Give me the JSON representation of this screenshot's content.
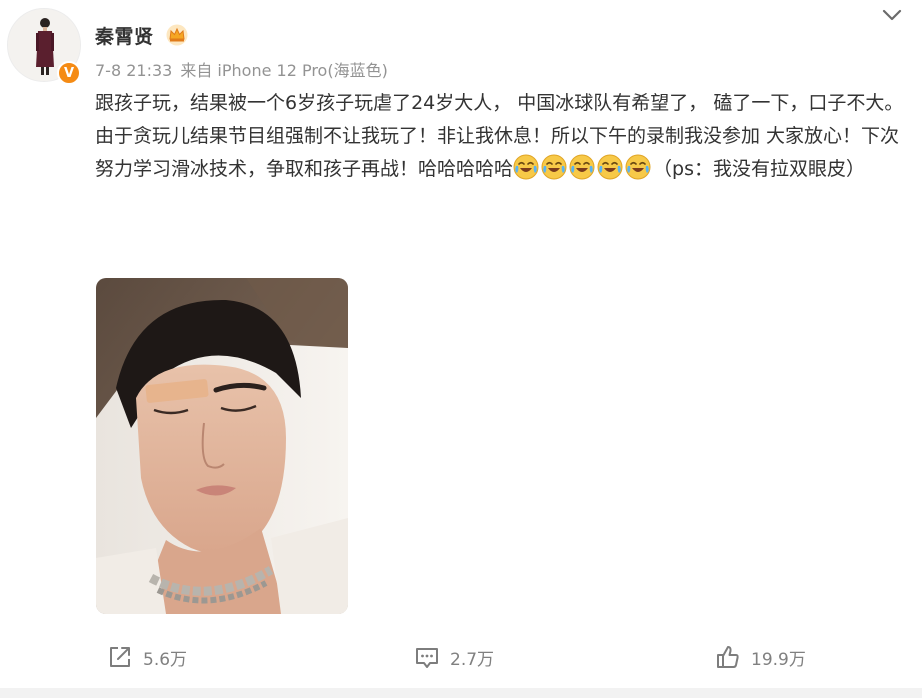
{
  "post": {
    "author": "秦霄贤",
    "badge_icon": "crown-icon",
    "verified_icon": "v-verified-icon",
    "verified_letter": "V",
    "date": "7-8 21:33",
    "source": "来自 iPhone 12 Pro(海蓝色)",
    "paragraphs": [
      "跟孩子玩，结果被一个6岁孩子玩虐了24岁大人， 中国冰球队有希望了， 磕了一下，口子不大。",
      "由于贪玩儿结果节目组强制不让我玩了！非让我休息！所以下午的录制我没参加 大家放心！下次努力学习滑冰技术，争取和孩子再战！哈哈哈哈哈"
    ],
    "emoji_name": "laugh-cry-emoji",
    "emoji_count": 5,
    "after_emoji_text": "（ps：我没有拉双眼皮）",
    "image_alt": "selfie-with-bandage-on-eyebrow"
  },
  "actions": {
    "repost": {
      "icon": "share-icon",
      "count": "5.6万"
    },
    "comment": {
      "icon": "comment-icon",
      "count": "2.7万"
    },
    "like": {
      "icon": "thumbs-up-icon",
      "count": "19.9万"
    }
  },
  "colors": {
    "text": "#333333",
    "meta": "#939393",
    "action": "#808080",
    "badge_orange": "#f58b14",
    "crown_gold": "#f5a623"
  }
}
